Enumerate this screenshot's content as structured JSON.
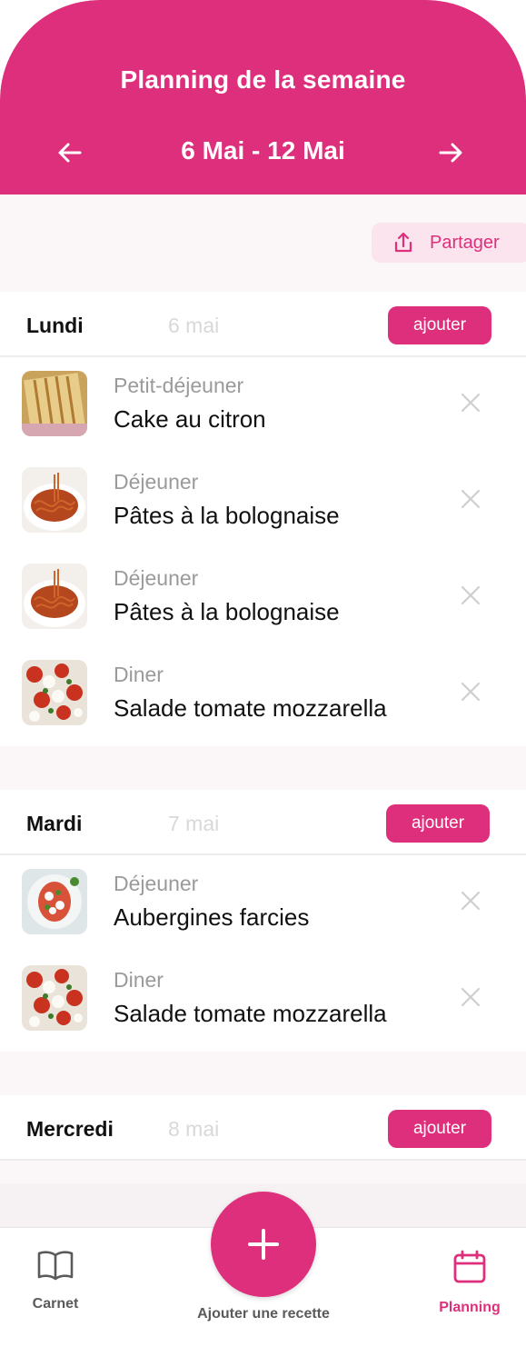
{
  "header": {
    "title": "Planning de la semaine",
    "week_range": "6 Mai - 12 Mai",
    "prev_icon": "arrow-left-icon",
    "next_icon": "arrow-right-icon"
  },
  "share": {
    "label": "Partager",
    "icon": "share-upload-icon"
  },
  "add_label": "ajouter",
  "days": [
    {
      "name": "Lundi",
      "date": "6 mai",
      "meals": [
        {
          "type": "Petit-déjeuner",
          "name": "Cake au citron",
          "thumb": "cake"
        },
        {
          "type": "Déjeuner",
          "name": "Pâtes à la bolognaise",
          "thumb": "pasta"
        },
        {
          "type": "Déjeuner",
          "name": "Pâtes à la bolognaise",
          "thumb": "pasta"
        },
        {
          "type": "Diner",
          "name": "Salade tomate mozzarella",
          "thumb": "salad"
        }
      ]
    },
    {
      "name": "Mardi",
      "date": "7 mai",
      "meals": [
        {
          "type": "Déjeuner",
          "name": "Aubergines farcies",
          "thumb": "aubergine"
        },
        {
          "type": "Diner",
          "name": "Salade tomate mozzarella",
          "thumb": "salad"
        }
      ]
    },
    {
      "name": "Mercredi",
      "date": "8 mai",
      "meals": []
    }
  ],
  "nav": {
    "carnet": "Carnet",
    "add_recipe": "Ajouter une recette",
    "planning": "Planning"
  },
  "colors": {
    "accent": "#de2f7c",
    "accent_light": "#fbe4ee",
    "background": "#fbf6f8"
  }
}
